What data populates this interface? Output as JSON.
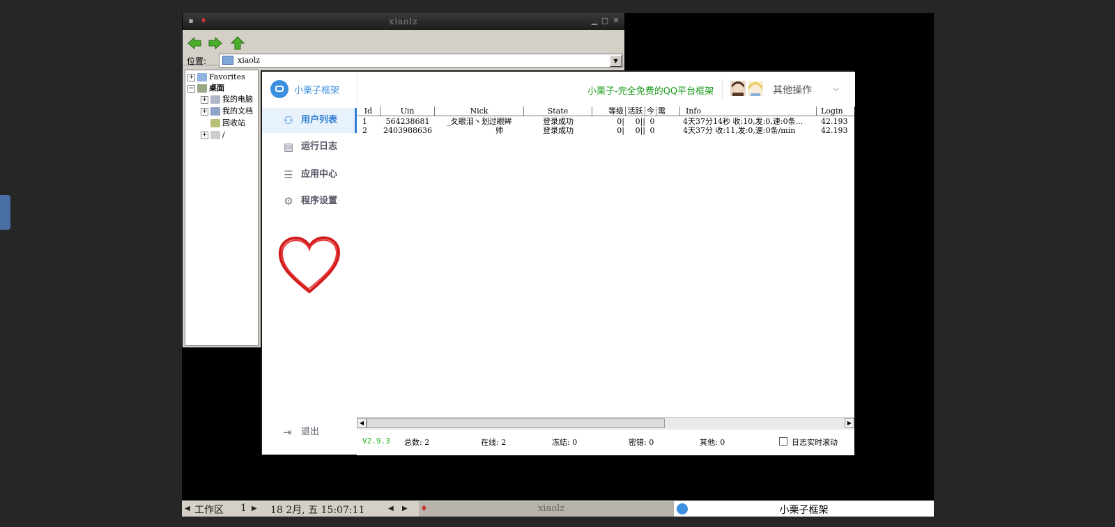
{
  "file_manager": {
    "title": "xiaolz",
    "location_label": "位置:",
    "location_value": "xiaolz",
    "tree": [
      {
        "label": "Favorites",
        "expander": "+"
      },
      {
        "label": "桌面",
        "expander": "−"
      },
      {
        "label": "我的电脑",
        "expander": "+"
      },
      {
        "label": "我的文档",
        "expander": "+"
      },
      {
        "label": "回收站",
        "expander": ""
      },
      {
        "label": "/",
        "expander": "+"
      }
    ]
  },
  "app": {
    "logo_text": "小栗子框架",
    "nav": [
      {
        "label": "用户列表",
        "icon": "user-icon",
        "glyph": "⚇"
      },
      {
        "label": "运行日志",
        "icon": "document-icon",
        "glyph": "▤"
      },
      {
        "label": "应用中心",
        "icon": "list-icon",
        "glyph": "☰"
      },
      {
        "label": "程序设置",
        "icon": "gear-icon",
        "glyph": "⚙"
      }
    ],
    "logout_label": "退出",
    "logout_glyph": "⇥",
    "slogan": "小栗子-完全免费的QQ平台框架",
    "other_ops": "其他操作",
    "table": {
      "columns": [
        "Id",
        "Uin",
        "Nick",
        "State",
        "等级",
        "活跃",
        "今",
        "需",
        "Info",
        "Login"
      ],
      "rows": [
        {
          "id": "1",
          "uin": "564238681",
          "nick": "_夂眼泪丶划过眼眸",
          "state": "登录成功",
          "level": "0|",
          "active": "0||",
          "today": "0",
          "need": "",
          "info": "4天37分14秒 收:10,发:0,速:0条...",
          "login": "42.193"
        },
        {
          "id": "2",
          "uin": "2403988636",
          "nick": "帅",
          "state": "登录成功",
          "level": "0|",
          "active": "0||",
          "today": "0",
          "need": "",
          "info": "4天37分 收:11,发:0,速:0条/min",
          "login": "42.193"
        }
      ]
    },
    "status": {
      "version": "V2.9.3",
      "total": "总数: 2",
      "online": "在线: 2",
      "frozen": "冻结: 0",
      "password_error": "密错: 0",
      "other": "其他: 0",
      "log_scroll": "日志实时滚动"
    }
  },
  "taskbar": {
    "workspace_label": "工作区",
    "workspace_num": "1",
    "datetime": "18 2月, 五 15:07:11",
    "window1": "xiaolz",
    "window2": "小栗子框架"
  },
  "colors": {
    "accent": "#3d8fe0",
    "slogan_green": "#1a9a1a",
    "version_green": "#22b422"
  }
}
